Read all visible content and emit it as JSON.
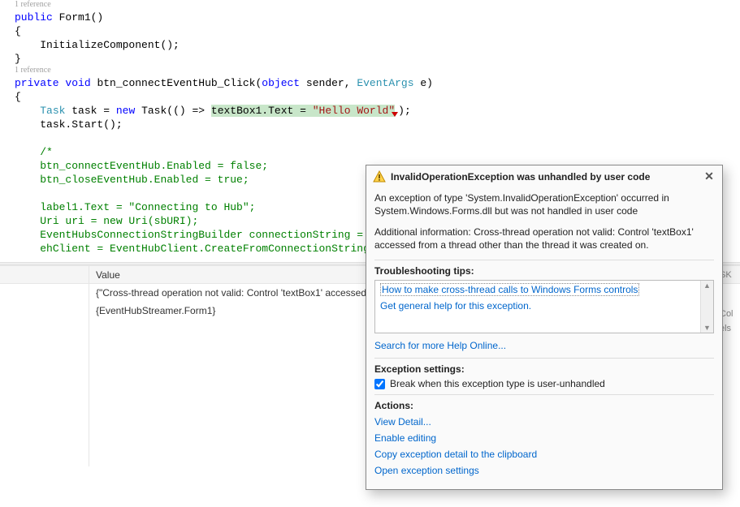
{
  "codelens": {
    "ref1": "1 reference",
    "ref2": "1 reference"
  },
  "code": {
    "kw_public": "public",
    "ctor": "Form1()",
    "brace_open": "{",
    "brace_close": "}",
    "init": "InitializeComponent();",
    "kw_private": "private",
    "kw_void": "void",
    "handler": "btn_connectEventHub_Click(",
    "kw_object": "object",
    "sender": " sender, ",
    "type_eventargs": "EventArgs",
    "eparen": " e)",
    "type_task": "Task",
    "task_decl": " task = ",
    "kw_new": "new",
    "task_ctor": " Task(() => ",
    "hl_expr": "textBox1.Text = ",
    "str_hello": "\"Hello World\"",
    "task_close": ");",
    "task_start": "task.Start();",
    "com_open": "/*",
    "com_l1": "btn_connectEventHub.Enabled = false;",
    "com_l2": "btn_closeEventHub.Enabled = true;",
    "com_blank": "",
    "com_l3": "label1.Text = \"Connecting to Hub\";",
    "com_l4": "Uri uri = new Uri(sbURI);",
    "com_l5": "EventHubsConnectionStringBuilder connectionString = new Ev",
    "com_l6": "ehClient = EventHubClient.CreateFromConnectionString(conne"
  },
  "grid": {
    "header_value": "Value",
    "row1": "{\"Cross-thread operation not valid: Control 'textBox1' accessed",
    "row2": "{EventHubStreamer.Form1}"
  },
  "right": {
    "sk": "SK",
    "col": "Col",
    "els": "els"
  },
  "popup": {
    "title": "InvalidOperationException was unhandled by user code",
    "p1": "An exception of type 'System.InvalidOperationException' occurred in System.Windows.Forms.dll but was not handled in user code",
    "p2": "Additional information: Cross-thread operation not valid: Control 'textBox1' accessed from a thread other than the thread it was created on.",
    "tips_header": "Troubleshooting tips:",
    "tip1": "How to make cross-thread calls to Windows Forms controls",
    "tip2": "Get general help for this exception.",
    "search": "Search for more Help Online...",
    "settings_header": "Exception settings:",
    "break_label": "Break when this exception type is user-unhandled",
    "actions_header": "Actions:",
    "a1": "View Detail...",
    "a2": "Enable editing",
    "a3": "Copy exception detail to the clipboard",
    "a4": "Open exception settings"
  }
}
